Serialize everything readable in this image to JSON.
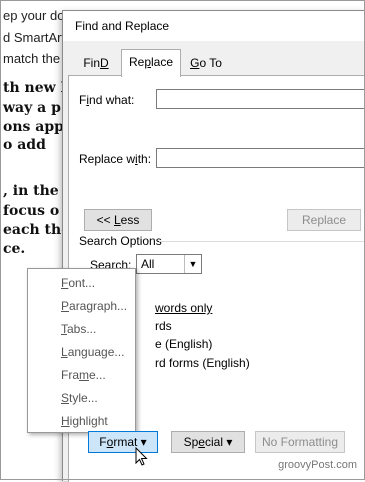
{
  "document": {
    "lines": [
      {
        "text": "ep your do",
        "style": "n"
      },
      {
        "text": "d SmartArt",
        "style": "n"
      },
      {
        "text": "match the",
        "style": "n"
      },
      {
        "text": "th new l",
        "style": "b"
      },
      {
        "text": "way a p",
        "style": "b"
      },
      {
        "text": "ons app",
        "style": "b"
      },
      {
        "text": "o add",
        "style": "b"
      },
      {
        "text": ", in the",
        "style": "b"
      },
      {
        "text": "focus o",
        "style": "b"
      },
      {
        "text": "each the",
        "style": "b"
      },
      {
        "text": "ce.",
        "style": "b"
      }
    ]
  },
  "dialog": {
    "title": "Find and Replace",
    "tabs": [
      {
        "label": "Find",
        "key": "D",
        "pre": "Fin",
        "post": ""
      },
      {
        "label": "Replace",
        "key": "p",
        "pre": "Re",
        "post": "lace"
      },
      {
        "label": "Go To",
        "key": "G",
        "pre": "",
        "post": "o To"
      }
    ],
    "find_what": {
      "label": "Find what:",
      "pre": "F",
      "key": "i",
      "post": "nd what:",
      "value": ""
    },
    "replace_with": {
      "label": "Replace with:",
      "pre": "Replace w",
      "key": "i",
      "post": "th:",
      "value": ""
    },
    "less_button": {
      "pre": "<< ",
      "key": "L",
      "post": "ess"
    },
    "replace_button": "Replace",
    "search_options": {
      "title": "Search Options",
      "search_label": {
        "pre": "Search",
        "key": ":",
        "post": ""
      },
      "search_value": "All",
      "visible_options": [
        {
          "pre": "",
          "key": "",
          "post": "words only",
          "underline_all": true
        },
        {
          "text": "rds"
        },
        {
          "text": "e (English)"
        },
        {
          "text": "rd forms (English)"
        }
      ]
    },
    "footer": {
      "format_button": {
        "pre": "F",
        "key": "o",
        "post": "rmat",
        "caret": "▾"
      },
      "special_button": {
        "pre": "Sp",
        "key": "e",
        "post": "cial",
        "caret": "▾"
      },
      "no_formatting_button": "No Formatting"
    }
  },
  "format_menu": {
    "items": [
      {
        "pre": "",
        "key": "F",
        "post": "ont..."
      },
      {
        "pre": "",
        "key": "P",
        "post": "aragraph..."
      },
      {
        "pre": "",
        "key": "T",
        "post": "abs..."
      },
      {
        "pre": "",
        "key": "L",
        "post": "anguage..."
      },
      {
        "pre": "Fra",
        "key": "m",
        "post": "e..."
      },
      {
        "pre": "",
        "key": "S",
        "post": "tyle..."
      },
      {
        "pre": "",
        "key": "H",
        "post": "ighlight"
      }
    ]
  },
  "watermark": "groovyPost.com",
  "icons": {
    "cursor": "mouse-pointer-icon",
    "dropdown": "chevron-down-icon"
  }
}
